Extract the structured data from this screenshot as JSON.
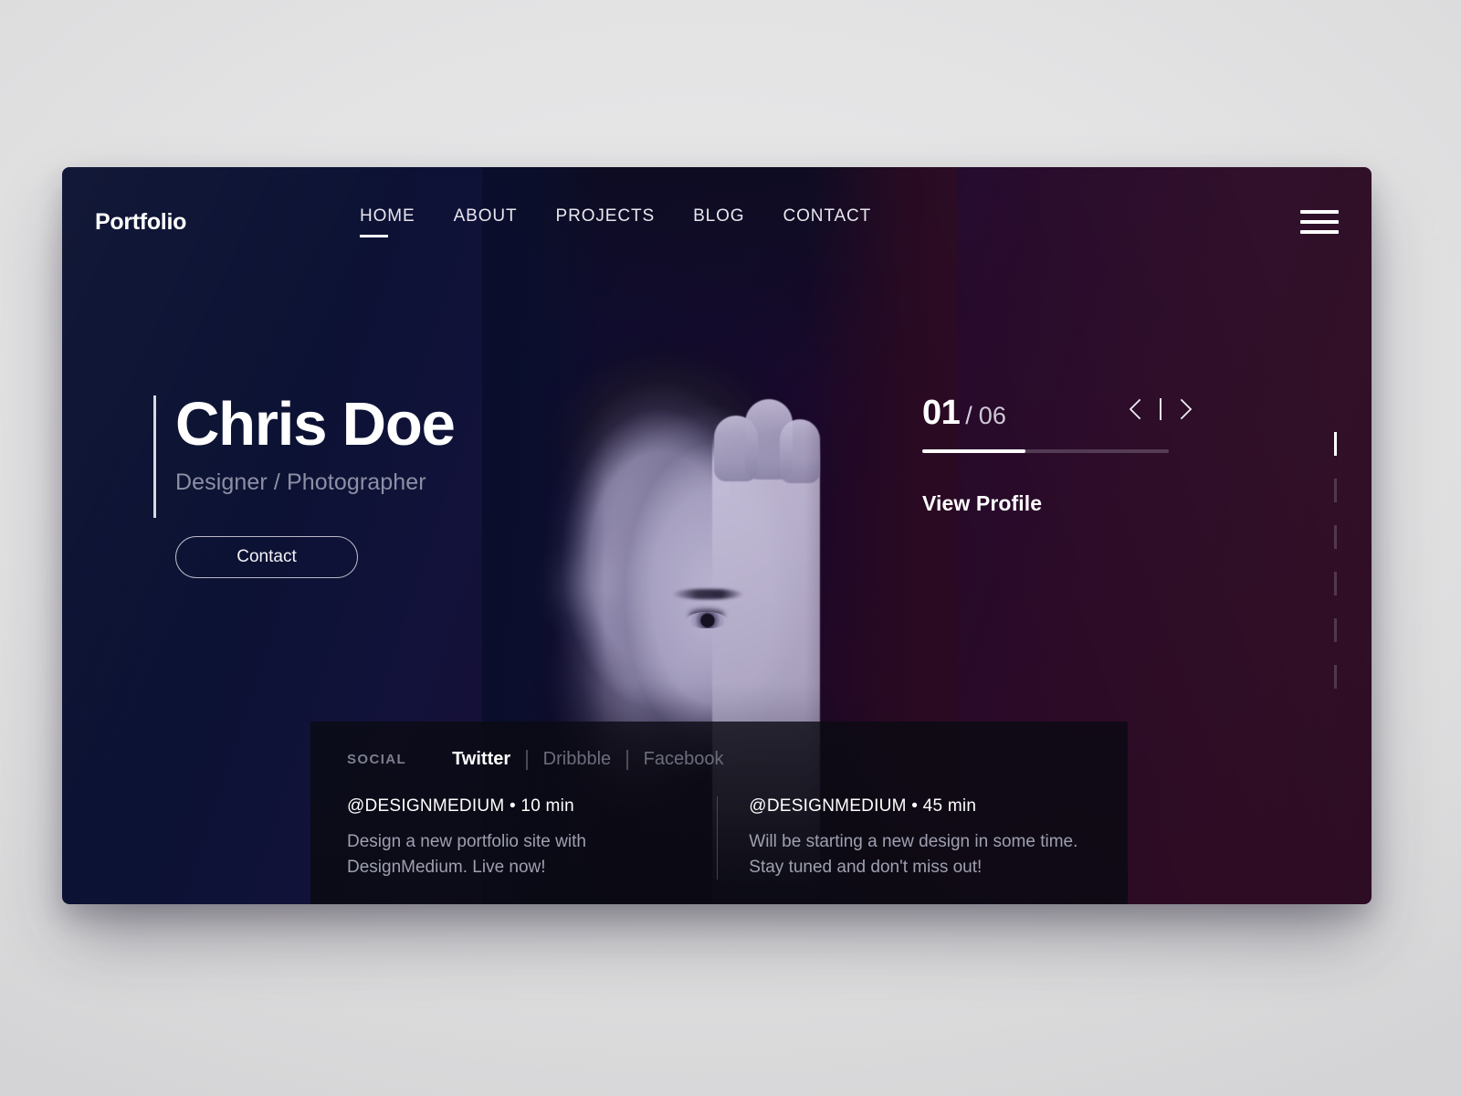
{
  "header": {
    "logo": "Portfolio",
    "nav": [
      {
        "label": "HOME",
        "active": true
      },
      {
        "label": "ABOUT",
        "active": false
      },
      {
        "label": "PROJECTS",
        "active": false
      },
      {
        "label": "BLOG",
        "active": false
      },
      {
        "label": "CONTACT",
        "active": false
      }
    ],
    "menu_icon": "hamburger-menu-icon"
  },
  "hero": {
    "name": "Chris Doe",
    "role": "Designer / Photographer",
    "cta_label": "Contact",
    "portrait_alt": "portrait of a man covering half his face with his hand"
  },
  "slider": {
    "current": "01",
    "separator": "/",
    "total": "06",
    "progress_percent": 42,
    "prev_icon": "chevron-left-icon",
    "next_icon": "chevron-right-icon",
    "divider_icon": "vertical-divider-icon",
    "view_profile_label": "View Profile",
    "dots": [
      {
        "active": true
      },
      {
        "active": false
      },
      {
        "active": false
      },
      {
        "active": false
      },
      {
        "active": false
      },
      {
        "active": false
      }
    ]
  },
  "social": {
    "label": "SOCIAL",
    "tabs": [
      {
        "label": "Twitter",
        "active": true
      },
      {
        "label": "Dribbble",
        "active": false
      },
      {
        "label": "Facebook",
        "active": false
      }
    ],
    "posts": [
      {
        "handle": "@DESIGNMEDIUM",
        "bullet": "•",
        "time": "10 min",
        "meta": "@DESIGNMEDIUM  •  10 min",
        "body": "Design a new portfolio site with DesignMedium. Live now!"
      },
      {
        "handle": "@DESIGNMEDIUM",
        "bullet": "•",
        "time": "45 min",
        "meta": "@DESIGNMEDIUM  •  45 min",
        "body": "Will be starting a new design in some time. Stay tuned and don't miss out!"
      }
    ]
  },
  "colors": {
    "page_background": "#e2e2e3",
    "hero_gradient_start": "#0a1030",
    "hero_gradient_end": "#2a0920",
    "accent_white": "#ffffff",
    "muted_text": "#8d8fa4",
    "social_panel": "#0a0a12"
  }
}
